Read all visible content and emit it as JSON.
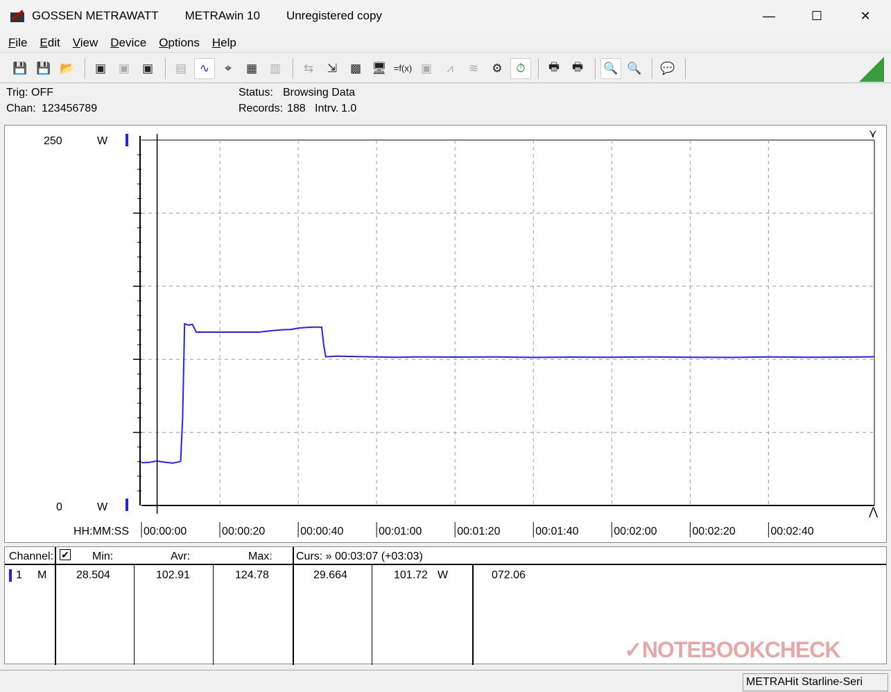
{
  "window": {
    "vendor": "GOSSEN METRAWATT",
    "app": "METRAwin 10",
    "registration": "Unregistered copy"
  },
  "menu": [
    "File",
    "Edit",
    "View",
    "Device",
    "Options",
    "Help"
  ],
  "toolbar_icons": [
    "save-export-icon",
    "save-import-icon",
    "open-folder-icon",
    "meter-send-icon",
    "meter-receive-icon",
    "memory-send-icon",
    "counter-icon",
    "waveform-icon",
    "crosshair-icon",
    "table-icon",
    "bar-chart-icon",
    "transfer-icon",
    "download-icon",
    "data-matrix-icon",
    "monitor-icon",
    "function-icon",
    "meter-icon",
    "wave-icon",
    "noise-icon",
    "settings-icon",
    "clock-icon",
    "print-icon",
    "print-setup-icon",
    "zoom-waveform-icon",
    "zoom-icon",
    "comment-icon"
  ],
  "status": {
    "trig_label": "Trig:",
    "trig_value": "OFF",
    "chan_label": "Chan:",
    "chan_value": "123456789",
    "status_label": "Status:",
    "status_value": "Browsing Data",
    "records_label": "Records:",
    "records_value": "188",
    "interval_label": "Intrv.",
    "interval_value": "1.0"
  },
  "chart_data": {
    "type": "line",
    "ylim": [
      0,
      250
    ],
    "y_top_label": "250",
    "y_bottom_label": "0",
    "y_unit": "W",
    "xlabel": "HH:MM:SS",
    "xlim_seconds": [
      0,
      187
    ],
    "x_tick_labels": [
      "00:00:00",
      "00:00:20",
      "00:00:40",
      "00:01:00",
      "00:01:20",
      "00:01:40",
      "00:02:00",
      "00:02:20",
      "00:02:40"
    ],
    "grid": true,
    "color": "#2020ff",
    "cursor_time_seconds": 4,
    "series": [
      {
        "x": [
          0,
          2,
          4,
          6,
          8,
          9,
          10,
          10.5,
          11,
          12,
          13,
          14,
          16,
          20,
          25,
          30,
          32,
          34,
          36,
          38,
          40,
          42,
          44,
          45,
          46,
          46.5,
          47,
          50,
          55,
          60,
          65,
          70,
          80,
          90,
          100,
          110,
          120,
          130,
          140,
          150,
          160,
          170,
          180,
          187
        ],
        "values": [
          29.2,
          29.5,
          30.4,
          29.6,
          29.0,
          29.5,
          30.2,
          60,
          124.3,
          123.4,
          123.9,
          118.6,
          118.6,
          118.6,
          118.6,
          118.6,
          119.2,
          119.8,
          120.2,
          120.4,
          121.3,
          121.8,
          122.0,
          122.0,
          121.9,
          110,
          101.7,
          102.2,
          101.9,
          101.6,
          101.4,
          101.6,
          101.5,
          101.6,
          101.3,
          101.5,
          101.4,
          101.6,
          101.4,
          101.3,
          101.6,
          101.4,
          101.5,
          101.7
        ]
      }
    ]
  },
  "table": {
    "channel_label": "Channel:",
    "min_label": "Min:",
    "avr_label": "Avr:",
    "max_label": "Max:",
    "cursor_label": "Curs: » 00:03:07 (+03:03)",
    "row": {
      "channel": "1",
      "mode": "M",
      "min": "28.504",
      "avr": "102.91",
      "max": "124.78",
      "cursor_value": "29.664",
      "value": "101.72",
      "unit": "W",
      "extra": "072.06"
    }
  },
  "statusbar": {
    "device": "METRAHit Starline-Seri"
  },
  "watermark": "NOTEBOOKCHECK"
}
